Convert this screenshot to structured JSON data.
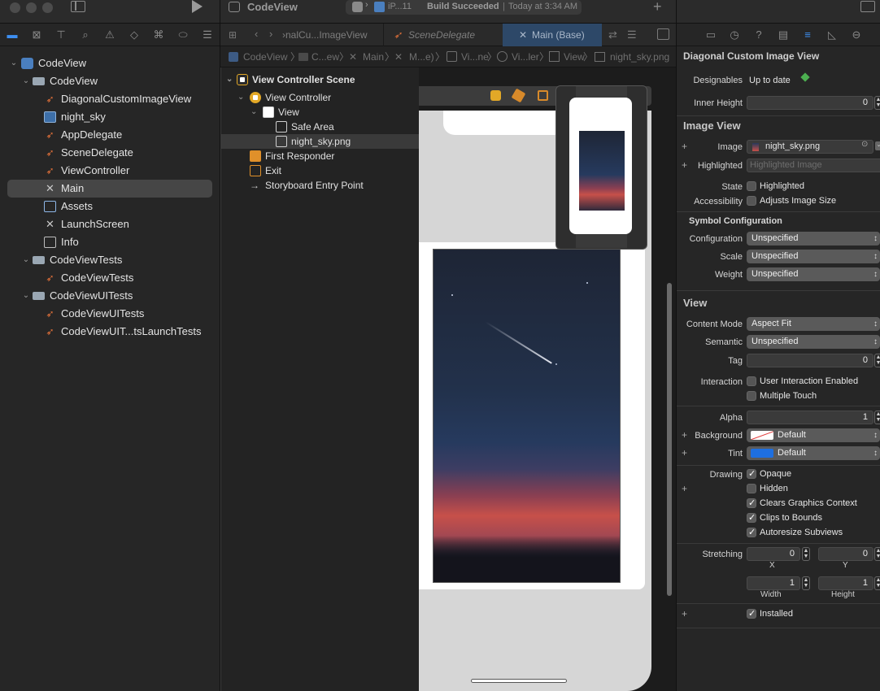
{
  "window": {
    "project_title": "CodeView",
    "scheme_device": "iP...11",
    "build_status": "Build Succeeded",
    "build_time": "Today at 3:34 AM",
    "add_symbol": "+"
  },
  "navigator": {
    "items": [
      {
        "label": "CodeView",
        "kind": "project"
      },
      {
        "label": "CodeView",
        "kind": "folder"
      },
      {
        "label": "DiagonalCustomImageView",
        "kind": "swift"
      },
      {
        "label": "night_sky",
        "kind": "image"
      },
      {
        "label": "AppDelegate",
        "kind": "swift"
      },
      {
        "label": "SceneDelegate",
        "kind": "swift"
      },
      {
        "label": "ViewController",
        "kind": "swift"
      },
      {
        "label": "Main",
        "kind": "storyboard"
      },
      {
        "label": "Assets",
        "kind": "assets"
      },
      {
        "label": "LaunchScreen",
        "kind": "storyboard"
      },
      {
        "label": "Info",
        "kind": "plist"
      },
      {
        "label": "CodeViewTests",
        "kind": "folder"
      },
      {
        "label": "CodeViewTests",
        "kind": "swift"
      },
      {
        "label": "CodeViewUITests",
        "kind": "folder"
      },
      {
        "label": "CodeViewUITests",
        "kind": "swift"
      },
      {
        "label": "CodeViewUIT...tsLaunchTests",
        "kind": "swift"
      }
    ]
  },
  "editor": {
    "tabs": [
      {
        "label": "›nalCu...ImageView"
      },
      {
        "label": "SceneDelegate"
      },
      {
        "label": "Main (Base)"
      }
    ],
    "jumpbar": [
      "CodeView",
      "C...ew",
      "Main",
      "M...e)",
      "Vi...ne",
      "Vi...ler",
      "View",
      "night_sky.png"
    ]
  },
  "outline": {
    "items": [
      {
        "label": "View Controller Scene"
      },
      {
        "label": "View Controller"
      },
      {
        "label": "View"
      },
      {
        "label": "Safe Area"
      },
      {
        "label": "night_sky.png"
      },
      {
        "label": "First Responder"
      },
      {
        "label": "Exit"
      },
      {
        "label": "Storyboard Entry Point"
      }
    ]
  },
  "inspector": {
    "class_title": "Diagonal Custom Image View",
    "designables_label": "Designables",
    "designables_value": "Up to date",
    "inner_height_label": "Inner Height",
    "inner_height_value": "0",
    "image_view_header": "Image View",
    "image_label": "Image",
    "image_value": "night_sky.png",
    "highlighted_label": "Highlighted",
    "highlighted_placeholder": "Highlighted Image",
    "state_label": "State",
    "state_checkbox": "Highlighted",
    "accessibility_label": "Accessibility",
    "accessibility_checkbox": "Adjusts Image Size",
    "symbol_config_header": "Symbol Configuration",
    "configuration_label": "Configuration",
    "configuration_value": "Unspecified",
    "scale_label": "Scale",
    "scale_value": "Unspecified",
    "weight_label": "Weight",
    "weight_value": "Unspecified",
    "view_header": "View",
    "content_mode_label": "Content Mode",
    "content_mode_value": "Aspect Fit",
    "semantic_label": "Semantic",
    "semantic_value": "Unspecified",
    "tag_label": "Tag",
    "tag_value": "0",
    "interaction_label": "Interaction",
    "user_interaction": "User Interaction Enabled",
    "multiple_touch": "Multiple Touch",
    "alpha_label": "Alpha",
    "alpha_value": "1",
    "background_label": "Background",
    "background_value": "Default",
    "tint_label": "Tint",
    "tint_value": "Default",
    "tint_color": "#1e6fe0",
    "drawing_label": "Drawing",
    "opaque": "Opaque",
    "hidden": "Hidden",
    "clears_graphics": "Clears Graphics Context",
    "clips_bounds": "Clips to Bounds",
    "autoresize": "Autoresize Subviews",
    "stretching_label": "Stretching",
    "stretch_x": "0",
    "stretch_y": "0",
    "x_caption": "X",
    "y_caption": "Y",
    "stretch_w": "1",
    "stretch_h": "1",
    "width_caption": "Width",
    "height_caption": "Height",
    "installed": "Installed"
  }
}
